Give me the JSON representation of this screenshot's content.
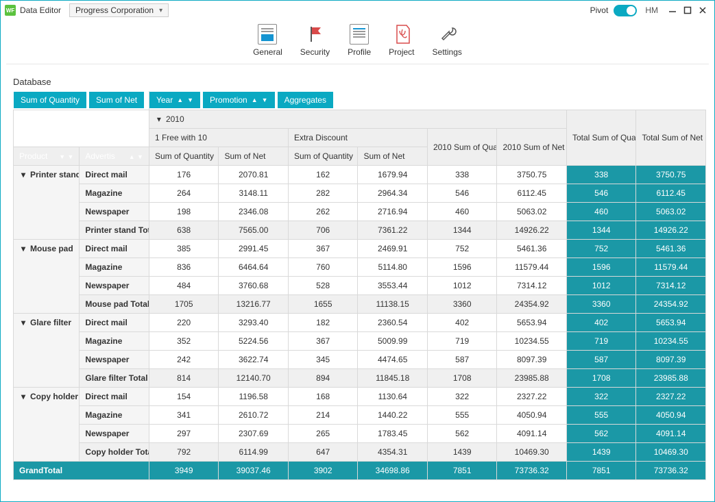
{
  "app": {
    "title": "Data Editor",
    "icon": "WF",
    "company": "Progress Corporation"
  },
  "titlebar": {
    "pivotLabel": "Pivot",
    "user": "HM"
  },
  "ribbon": {
    "general": "General",
    "security": "Security",
    "profile": "Profile",
    "project": "Project",
    "settings": "Settings"
  },
  "section": {
    "title": "Database"
  },
  "filters": {
    "sumQty": "Sum of Quantity",
    "sumNet": "Sum of Net",
    "year": "Year",
    "promotion": "Promotion",
    "aggregates": "Aggregates",
    "product": "Product",
    "advertis": "Advertis"
  },
  "headers": {
    "yearVal": "2010",
    "promo1": "1 Free with 10",
    "promo2": "Extra Discount",
    "yearSumQua": "2010 Sum of Qua",
    "yearSumNet": "2010 Sum of Net",
    "totSumQua": "Total Sum of Qua",
    "totSumNet": "Total Sum of Net",
    "sumQty": "Sum of Quantity",
    "sumNet": "Sum of Net",
    "grandTotal": "GrandTotal"
  },
  "labels": {
    "directMail": "Direct mail",
    "magazine": "Magazine",
    "newspaper": "Newspaper"
  },
  "groups": [
    {
      "name": "Printer stand",
      "totalLabel": "Printer stand Total",
      "rows": [
        {
          "adv": "directMail",
          "q1": "176",
          "n1": "2070.81",
          "q2": "162",
          "n2": "1679.94",
          "yq": "338",
          "yn": "3750.75",
          "tq": "338",
          "tn": "3750.75"
        },
        {
          "adv": "magazine",
          "q1": "264",
          "n1": "3148.11",
          "q2": "282",
          "n2": "2964.34",
          "yq": "546",
          "yn": "6112.45",
          "tq": "546",
          "tn": "6112.45"
        },
        {
          "adv": "newspaper",
          "q1": "198",
          "n1": "2346.08",
          "q2": "262",
          "n2": "2716.94",
          "yq": "460",
          "yn": "5063.02",
          "tq": "460",
          "tn": "5063.02"
        }
      ],
      "total": {
        "q1": "638",
        "n1": "7565.00",
        "q2": "706",
        "n2": "7361.22",
        "yq": "1344",
        "yn": "14926.22",
        "tq": "1344",
        "tn": "14926.22"
      }
    },
    {
      "name": "Mouse pad",
      "totalLabel": "Mouse pad Total",
      "rows": [
        {
          "adv": "directMail",
          "q1": "385",
          "n1": "2991.45",
          "q2": "367",
          "n2": "2469.91",
          "yq": "752",
          "yn": "5461.36",
          "tq": "752",
          "tn": "5461.36"
        },
        {
          "adv": "magazine",
          "q1": "836",
          "n1": "6464.64",
          "q2": "760",
          "n2": "5114.80",
          "yq": "1596",
          "yn": "11579.44",
          "tq": "1596",
          "tn": "11579.44"
        },
        {
          "adv": "newspaper",
          "q1": "484",
          "n1": "3760.68",
          "q2": "528",
          "n2": "3553.44",
          "yq": "1012",
          "yn": "7314.12",
          "tq": "1012",
          "tn": "7314.12"
        }
      ],
      "total": {
        "q1": "1705",
        "n1": "13216.77",
        "q2": "1655",
        "n2": "11138.15",
        "yq": "3360",
        "yn": "24354.92",
        "tq": "3360",
        "tn": "24354.92"
      }
    },
    {
      "name": "Glare filter",
      "totalLabel": "Glare filter Total",
      "rows": [
        {
          "adv": "directMail",
          "q1": "220",
          "n1": "3293.40",
          "q2": "182",
          "n2": "2360.54",
          "yq": "402",
          "yn": "5653.94",
          "tq": "402",
          "tn": "5653.94"
        },
        {
          "adv": "magazine",
          "q1": "352",
          "n1": "5224.56",
          "q2": "367",
          "n2": "5009.99",
          "yq": "719",
          "yn": "10234.55",
          "tq": "719",
          "tn": "10234.55"
        },
        {
          "adv": "newspaper",
          "q1": "242",
          "n1": "3622.74",
          "q2": "345",
          "n2": "4474.65",
          "yq": "587",
          "yn": "8097.39",
          "tq": "587",
          "tn": "8097.39"
        }
      ],
      "total": {
        "q1": "814",
        "n1": "12140.70",
        "q2": "894",
        "n2": "11845.18",
        "yq": "1708",
        "yn": "23985.88",
        "tq": "1708",
        "tn": "23985.88"
      }
    },
    {
      "name": "Copy holder",
      "totalLabel": "Copy holder Total",
      "rows": [
        {
          "adv": "directMail",
          "q1": "154",
          "n1": "1196.58",
          "q2": "168",
          "n2": "1130.64",
          "yq": "322",
          "yn": "2327.22",
          "tq": "322",
          "tn": "2327.22"
        },
        {
          "adv": "magazine",
          "q1": "341",
          "n1": "2610.72",
          "q2": "214",
          "n2": "1440.22",
          "yq": "555",
          "yn": "4050.94",
          "tq": "555",
          "tn": "4050.94"
        },
        {
          "adv": "newspaper",
          "q1": "297",
          "n1": "2307.69",
          "q2": "265",
          "n2": "1783.45",
          "yq": "562",
          "yn": "4091.14",
          "tq": "562",
          "tn": "4091.14"
        }
      ],
      "total": {
        "q1": "792",
        "n1": "6114.99",
        "q2": "647",
        "n2": "4354.31",
        "yq": "1439",
        "yn": "10469.30",
        "tq": "1439",
        "tn": "10469.30"
      }
    }
  ],
  "grand": {
    "q1": "3949",
    "n1": "39037.46",
    "q2": "3902",
    "n2": "34698.86",
    "yq": "7851",
    "yn": "73736.32",
    "tq": "7851",
    "tn": "73736.32"
  }
}
